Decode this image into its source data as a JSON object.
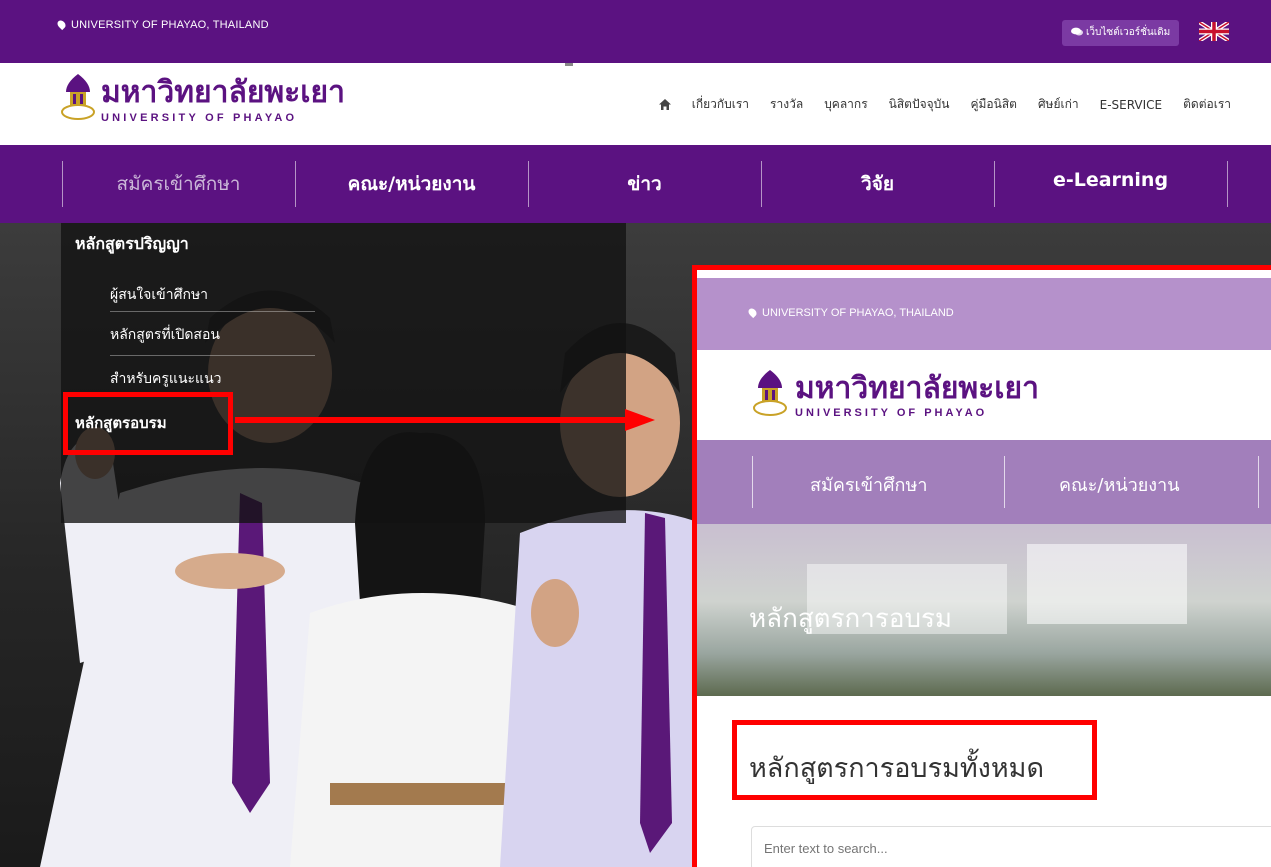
{
  "topbar": {
    "location": "UNIVERSITY OF PHAYAO, THAILAND",
    "old_site_label": "เว็บไซต์เวอร์ชั่นเดิม",
    "lang_flag": "uk-flag-icon",
    "bg": "#5b1281"
  },
  "logo": {
    "name_th": "มหาวิทยาลัยพะเยา",
    "name_en": "UNIVERSITY OF PHAYAO"
  },
  "topnav": {
    "home_icon": "home-icon",
    "items": [
      "เกี่ยวกับเรา",
      "รางวัล",
      "บุคลากร",
      "นิสิตปัจจุบัน",
      "คู่มือนิสิต",
      "ศิษย์เก่า",
      "E-SERVICE",
      "ติดต่อเรา"
    ]
  },
  "mainnav": {
    "items": [
      "สมัครเข้าศึกษา",
      "คณะ/หน่วยงาน",
      "ข่าว",
      "วิจัย",
      "e-Learning"
    ],
    "active": "สมัครเข้าศึกษา"
  },
  "dropdown": {
    "title": "หลักสูตรปริญญา",
    "items": [
      "ผู้สนใจเข้าศึกษา",
      "หลักสูตรที่เปิดสอน",
      "สำหรับครูแนะแนว"
    ],
    "highlighted": "หลักสูตรอบรม"
  },
  "inset": {
    "location": "UNIVERSITY OF PHAYAO, THAILAND",
    "logo_th": "มหาวิทยาลัยพะเยา",
    "logo_en": "UNIVERSITY OF PHAYAO",
    "nav_items": [
      "สมัครเข้าศึกษา",
      "คณะ/หน่วยงาน"
    ],
    "banner_title": "หลักสูตรการอบรม",
    "section_title": "หลักสูตรการอบรมทั้งหมด",
    "search_placeholder": "Enter text to search..."
  },
  "colors": {
    "brand_purple": "#5b1281",
    "highlight_red": "#ff0000"
  }
}
